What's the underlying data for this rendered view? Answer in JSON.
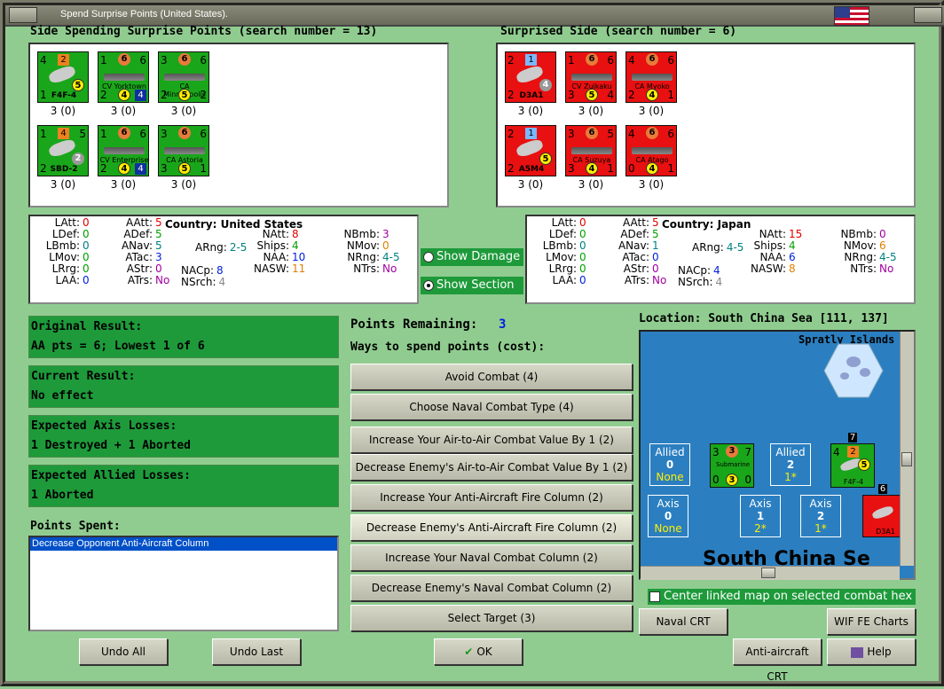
{
  "window": {
    "title": "Spend Surprise Points (United States)."
  },
  "headers": {
    "spending": "Side Spending Surprise Points (search number = 13)",
    "surprised": "Surprised Side (search number = 6)"
  },
  "us_units": [
    {
      "name": "F4F-4",
      "kind": "plane",
      "tl": "4",
      "tm": "2",
      "bl": "1",
      "circ": "5",
      "count": "3 (0)"
    },
    {
      "name": "CV Yorktown",
      "kind": "ship",
      "tl": "1",
      "tm": "6",
      "tr": "6",
      "bl": "2",
      "bm": "4",
      "br": "4",
      "count": "3 (0)"
    },
    {
      "name": "CA Minneapolis",
      "kind": "ship",
      "tl": "3",
      "tm": "6",
      "tr": "6",
      "bl": "2",
      "bm": "5",
      "br": "2",
      "count": "3 (0)"
    },
    {
      "name": "SBD-2",
      "kind": "plane",
      "tl": "1",
      "tm": "4",
      "tr": "5",
      "bl": "2",
      "circ": "2",
      "count": "3 (0)"
    },
    {
      "name": "CV Enterprise",
      "kind": "ship",
      "tl": "1",
      "tm": "6",
      "tr": "6",
      "bl": "2",
      "bm": "4",
      "br": "4",
      "count": "3 (0)"
    },
    {
      "name": "CA Astoria",
      "kind": "ship",
      "tl": "3",
      "tm": "6",
      "tr": "6",
      "bl": "3",
      "bm": "5",
      "br": "1",
      "count": "3 (0)"
    }
  ],
  "jp_units": [
    {
      "name": "D3A1",
      "kind": "plane",
      "tl": "2",
      "tm": "1",
      "bl": "2",
      "circ": "4",
      "count": "3 (0)"
    },
    {
      "name": "CV Zuikaku",
      "kind": "ship",
      "tl": "1",
      "tm": "6",
      "tr": "6",
      "bl": "3",
      "bm": "5",
      "br": "4",
      "count": "3 (0)"
    },
    {
      "name": "CA Myoko",
      "kind": "ship",
      "tl": "4",
      "tm": "6",
      "tr": "6",
      "bl": "2",
      "bm": "4",
      "br": "1",
      "count": "3 (0)"
    },
    {
      "name": "A5M4",
      "kind": "plane",
      "tl": "2",
      "tm": "1",
      "bl": "2",
      "circ": "5",
      "count": "3 (0)"
    },
    {
      "name": "CA Suzuya",
      "kind": "ship",
      "tl": "3",
      "tm": "6",
      "tr": "5",
      "bl": "3",
      "bm": "4",
      "br": "1",
      "count": "3 (0)"
    },
    {
      "name": "CA Atago",
      "kind": "ship",
      "tl": "4",
      "tm": "6",
      "tr": "6",
      "bl": "0",
      "bm": "4",
      "br": "1",
      "count": "3 (0)"
    }
  ],
  "us_stats": {
    "country_label": "Country:",
    "country": "United States",
    "LAtt": "0",
    "LDef": "0",
    "LBmb": "0",
    "LMov": "0",
    "LRrg": "0",
    "LAA": "0",
    "AAtt": "5",
    "ADef": "5",
    "ANav": "5",
    "ATac": "3",
    "AStr": "0",
    "ATrs": "No",
    "ARng": "2-5",
    "NACp": "8",
    "NSrch": "4",
    "NAtt": "8",
    "Ships": "4",
    "NAA": "10",
    "NASW": "11",
    "NBmb": "3",
    "NMov": "0",
    "NRng": "4-5",
    "NTrs": "No"
  },
  "jp_stats": {
    "country_label": "Country:",
    "country": "Japan",
    "LAtt": "0",
    "LDef": "0",
    "LBmb": "0",
    "LMov": "0",
    "LRrg": "0",
    "LAA": "0",
    "AAtt": "5",
    "ADef": "5",
    "ANav": "1",
    "ATac": "0",
    "AStr": "0",
    "ATrs": "No",
    "ARng": "4-5",
    "NACp": "4",
    "NSrch": "4",
    "NAtt": "15",
    "Ships": "4",
    "NAA": "6",
    "NASW": "8",
    "NBmb": "0",
    "NMov": "6",
    "NRng": "4-5",
    "NTrs": "No"
  },
  "labels": {
    "LAtt": "LAtt:",
    "LDef": "LDef:",
    "LBmb": "LBmb:",
    "LMov": "LMov:",
    "LRrg": "LRrg:",
    "LAA": "LAA:",
    "AAtt": "AAtt:",
    "ADef": "ADef:",
    "ANav": "ANav:",
    "ATac": "ATac:",
    "AStr": "AStr:",
    "ATrs": "ATrs:",
    "ARng": "ARng:",
    "NACp": "NACp:",
    "NSrch": "NSrch:",
    "NAtt": "NAtt:",
    "Ships": "Ships:",
    "NAA": "NAA:",
    "NASW": "NASW:",
    "NBmb": "NBmb:",
    "NMov": "NMov:",
    "NRng": "NRng:",
    "NTrs": "NTrs:"
  },
  "toggles": {
    "show_damage": "Show Damage",
    "show_section": "Show Section"
  },
  "results": {
    "original_title": "Original Result:",
    "original_value": "AA pts = 6; Lowest 1 of 6",
    "current_title": "Current Result:",
    "current_value": "No effect",
    "axis_title": "Expected Axis Losses:",
    "axis_value": "1 Destroyed + 1 Aborted",
    "allied_title": "Expected Allied Losses:",
    "allied_value": "1 Aborted"
  },
  "points": {
    "spent_label": "Points Spent:",
    "spent_items": [
      "Decrease Opponent Anti-Aircraft Column"
    ],
    "remaining_label": "Points Remaining:",
    "remaining_value": "3",
    "ways_label": "Ways to spend points (cost):"
  },
  "options": [
    "Avoid Combat (4)",
    "Choose Naval Combat Type (4)",
    "Increase Your Air-to-Air Combat Value By 1 (2)",
    "Decrease Enemy's Air-to-Air Combat Value By 1 (2)",
    "Increase Your Anti-Aircraft Fire Column (2)",
    "Decrease Enemy's Anti-Aircraft Fire Column (2)",
    "Increase Your Naval Combat Column (2)",
    "Decrease Enemy's Naval Combat Column (2)",
    "Select Target (3)"
  ],
  "map": {
    "location": "Location: South China Sea [111, 137]",
    "island_label": "Spratly Islands (",
    "sea_label": "South China Se",
    "allied": [
      {
        "title": "Allied",
        "num": "0",
        "sub": "None"
      },
      {
        "title": "Allied",
        "num": "2",
        "sub": "1*"
      }
    ],
    "axis": [
      {
        "title": "Axis",
        "num": "0",
        "sub": "None"
      },
      {
        "title": "Axis",
        "num": "1",
        "sub": "2*"
      },
      {
        "title": "Axis",
        "num": "2",
        "sub": "1*"
      }
    ],
    "sub_counter": {
      "name": "Submarine",
      "tl": "3",
      "tm": "3",
      "tr": "7",
      "bl": "0",
      "bm": "3",
      "br": "0"
    },
    "f4f_counter": {
      "name": "F4F-4",
      "tl": "4",
      "tm": "2",
      "circ": "5",
      "stack": "7"
    },
    "d3a_counter": {
      "name": "D3A1",
      "stack": "6"
    },
    "center_label": "Center linked map on selected combat hex"
  },
  "buttons": {
    "naval_crt": "Naval CRT",
    "wif_charts": "WIF FE Charts",
    "aa_crt": "Anti-aircraft CRT",
    "help": "Help",
    "undo_all": "Undo All",
    "undo_last": "Undo Last",
    "ok": "OK"
  },
  "colors": {
    "us_counter": "#1aa61a",
    "jp_counter": "#e81010",
    "background": "#90cc90",
    "result_box": "#1e9a3a",
    "sea": "#2b7fc0"
  }
}
